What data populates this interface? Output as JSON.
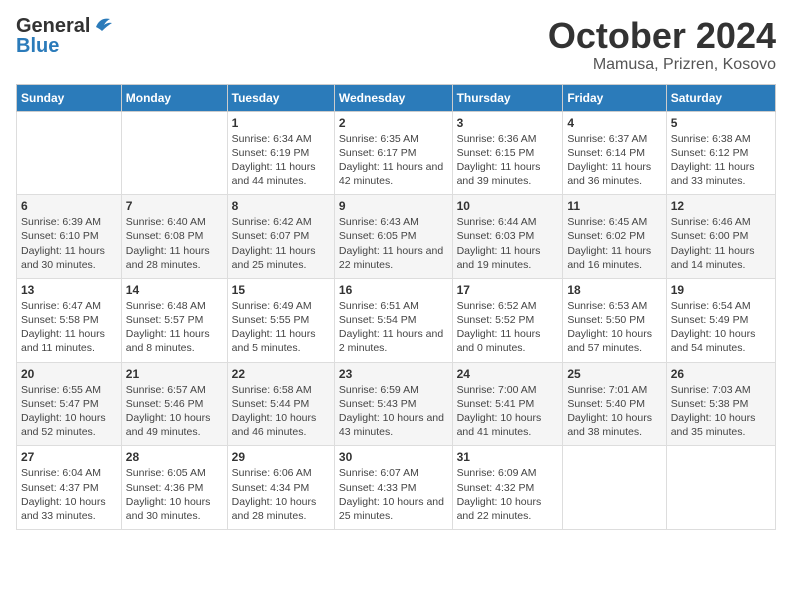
{
  "logo": {
    "general": "General",
    "blue": "Blue"
  },
  "title": "October 2024",
  "subtitle": "Mamusa, Prizren, Kosovo",
  "weekdays": [
    "Sunday",
    "Monday",
    "Tuesday",
    "Wednesday",
    "Thursday",
    "Friday",
    "Saturday"
  ],
  "weeks": [
    [
      {
        "day": "",
        "sunrise": "",
        "sunset": "",
        "daylight": ""
      },
      {
        "day": "",
        "sunrise": "",
        "sunset": "",
        "daylight": ""
      },
      {
        "day": "1",
        "sunrise": "Sunrise: 6:34 AM",
        "sunset": "Sunset: 6:19 PM",
        "daylight": "Daylight: 11 hours and 44 minutes."
      },
      {
        "day": "2",
        "sunrise": "Sunrise: 6:35 AM",
        "sunset": "Sunset: 6:17 PM",
        "daylight": "Daylight: 11 hours and 42 minutes."
      },
      {
        "day": "3",
        "sunrise": "Sunrise: 6:36 AM",
        "sunset": "Sunset: 6:15 PM",
        "daylight": "Daylight: 11 hours and 39 minutes."
      },
      {
        "day": "4",
        "sunrise": "Sunrise: 6:37 AM",
        "sunset": "Sunset: 6:14 PM",
        "daylight": "Daylight: 11 hours and 36 minutes."
      },
      {
        "day": "5",
        "sunrise": "Sunrise: 6:38 AM",
        "sunset": "Sunset: 6:12 PM",
        "daylight": "Daylight: 11 hours and 33 minutes."
      }
    ],
    [
      {
        "day": "6",
        "sunrise": "Sunrise: 6:39 AM",
        "sunset": "Sunset: 6:10 PM",
        "daylight": "Daylight: 11 hours and 30 minutes."
      },
      {
        "day": "7",
        "sunrise": "Sunrise: 6:40 AM",
        "sunset": "Sunset: 6:08 PM",
        "daylight": "Daylight: 11 hours and 28 minutes."
      },
      {
        "day": "8",
        "sunrise": "Sunrise: 6:42 AM",
        "sunset": "Sunset: 6:07 PM",
        "daylight": "Daylight: 11 hours and 25 minutes."
      },
      {
        "day": "9",
        "sunrise": "Sunrise: 6:43 AM",
        "sunset": "Sunset: 6:05 PM",
        "daylight": "Daylight: 11 hours and 22 minutes."
      },
      {
        "day": "10",
        "sunrise": "Sunrise: 6:44 AM",
        "sunset": "Sunset: 6:03 PM",
        "daylight": "Daylight: 11 hours and 19 minutes."
      },
      {
        "day": "11",
        "sunrise": "Sunrise: 6:45 AM",
        "sunset": "Sunset: 6:02 PM",
        "daylight": "Daylight: 11 hours and 16 minutes."
      },
      {
        "day": "12",
        "sunrise": "Sunrise: 6:46 AM",
        "sunset": "Sunset: 6:00 PM",
        "daylight": "Daylight: 11 hours and 14 minutes."
      }
    ],
    [
      {
        "day": "13",
        "sunrise": "Sunrise: 6:47 AM",
        "sunset": "Sunset: 5:58 PM",
        "daylight": "Daylight: 11 hours and 11 minutes."
      },
      {
        "day": "14",
        "sunrise": "Sunrise: 6:48 AM",
        "sunset": "Sunset: 5:57 PM",
        "daylight": "Daylight: 11 hours and 8 minutes."
      },
      {
        "day": "15",
        "sunrise": "Sunrise: 6:49 AM",
        "sunset": "Sunset: 5:55 PM",
        "daylight": "Daylight: 11 hours and 5 minutes."
      },
      {
        "day": "16",
        "sunrise": "Sunrise: 6:51 AM",
        "sunset": "Sunset: 5:54 PM",
        "daylight": "Daylight: 11 hours and 2 minutes."
      },
      {
        "day": "17",
        "sunrise": "Sunrise: 6:52 AM",
        "sunset": "Sunset: 5:52 PM",
        "daylight": "Daylight: 11 hours and 0 minutes."
      },
      {
        "day": "18",
        "sunrise": "Sunrise: 6:53 AM",
        "sunset": "Sunset: 5:50 PM",
        "daylight": "Daylight: 10 hours and 57 minutes."
      },
      {
        "day": "19",
        "sunrise": "Sunrise: 6:54 AM",
        "sunset": "Sunset: 5:49 PM",
        "daylight": "Daylight: 10 hours and 54 minutes."
      }
    ],
    [
      {
        "day": "20",
        "sunrise": "Sunrise: 6:55 AM",
        "sunset": "Sunset: 5:47 PM",
        "daylight": "Daylight: 10 hours and 52 minutes."
      },
      {
        "day": "21",
        "sunrise": "Sunrise: 6:57 AM",
        "sunset": "Sunset: 5:46 PM",
        "daylight": "Daylight: 10 hours and 49 minutes."
      },
      {
        "day": "22",
        "sunrise": "Sunrise: 6:58 AM",
        "sunset": "Sunset: 5:44 PM",
        "daylight": "Daylight: 10 hours and 46 minutes."
      },
      {
        "day": "23",
        "sunrise": "Sunrise: 6:59 AM",
        "sunset": "Sunset: 5:43 PM",
        "daylight": "Daylight: 10 hours and 43 minutes."
      },
      {
        "day": "24",
        "sunrise": "Sunrise: 7:00 AM",
        "sunset": "Sunset: 5:41 PM",
        "daylight": "Daylight: 10 hours and 41 minutes."
      },
      {
        "day": "25",
        "sunrise": "Sunrise: 7:01 AM",
        "sunset": "Sunset: 5:40 PM",
        "daylight": "Daylight: 10 hours and 38 minutes."
      },
      {
        "day": "26",
        "sunrise": "Sunrise: 7:03 AM",
        "sunset": "Sunset: 5:38 PM",
        "daylight": "Daylight: 10 hours and 35 minutes."
      }
    ],
    [
      {
        "day": "27",
        "sunrise": "Sunrise: 6:04 AM",
        "sunset": "Sunset: 4:37 PM",
        "daylight": "Daylight: 10 hours and 33 minutes."
      },
      {
        "day": "28",
        "sunrise": "Sunrise: 6:05 AM",
        "sunset": "Sunset: 4:36 PM",
        "daylight": "Daylight: 10 hours and 30 minutes."
      },
      {
        "day": "29",
        "sunrise": "Sunrise: 6:06 AM",
        "sunset": "Sunset: 4:34 PM",
        "daylight": "Daylight: 10 hours and 28 minutes."
      },
      {
        "day": "30",
        "sunrise": "Sunrise: 6:07 AM",
        "sunset": "Sunset: 4:33 PM",
        "daylight": "Daylight: 10 hours and 25 minutes."
      },
      {
        "day": "31",
        "sunrise": "Sunrise: 6:09 AM",
        "sunset": "Sunset: 4:32 PM",
        "daylight": "Daylight: 10 hours and 22 minutes."
      },
      {
        "day": "",
        "sunrise": "",
        "sunset": "",
        "daylight": ""
      },
      {
        "day": "",
        "sunrise": "",
        "sunset": "",
        "daylight": ""
      }
    ]
  ]
}
